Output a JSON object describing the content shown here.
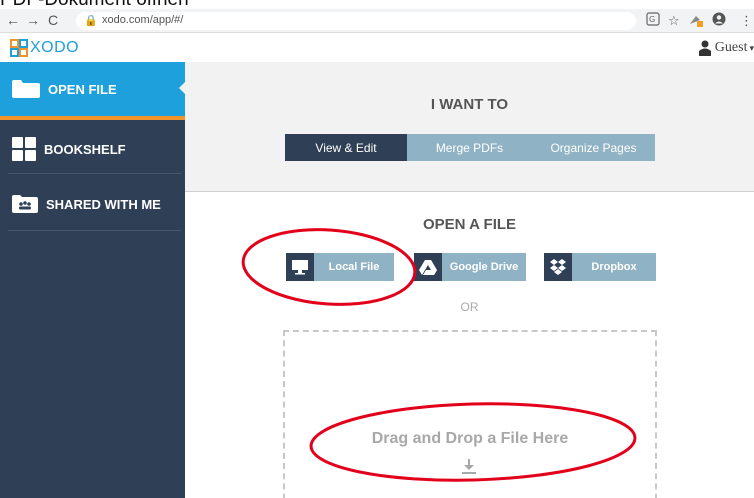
{
  "caption": "PDF-Dokument öffnen",
  "browser": {
    "url": "xodo.com/app/#/",
    "back_icon": "arrow-left-icon",
    "forward_icon": "arrow-right-icon",
    "reload_icon": "reload-icon"
  },
  "app": {
    "logo_text": "XODO",
    "user_label": "Guest"
  },
  "sidebar": {
    "items": [
      {
        "label": "OPEN FILE",
        "icon": "folder-icon",
        "active": true
      },
      {
        "label": "BOOKSHELF",
        "icon": "grid-icon",
        "active": false
      },
      {
        "label": "SHARED WITH ME",
        "icon": "people-icon",
        "active": false
      }
    ]
  },
  "want": {
    "title": "I WANT TO",
    "options": [
      "View & Edit",
      "Merge PDFs",
      "Organize Pages"
    ],
    "selected": "View & Edit"
  },
  "open": {
    "title": "OPEN A FILE",
    "sources": [
      {
        "label": "Local File",
        "icon": "monitor-icon"
      },
      {
        "label": "Google Drive",
        "icon": "google-drive-icon"
      },
      {
        "label": "Dropbox",
        "icon": "dropbox-icon"
      }
    ],
    "or_text": "OR",
    "drop_text": "Drag and Drop a File Here"
  },
  "colors": {
    "sidebar_bg": "#2f3f55",
    "active_blue": "#1ea0dc",
    "accent_orange": "#f0932b",
    "button_light": "#8fb3c4",
    "annotation_red": "#e3001b"
  }
}
